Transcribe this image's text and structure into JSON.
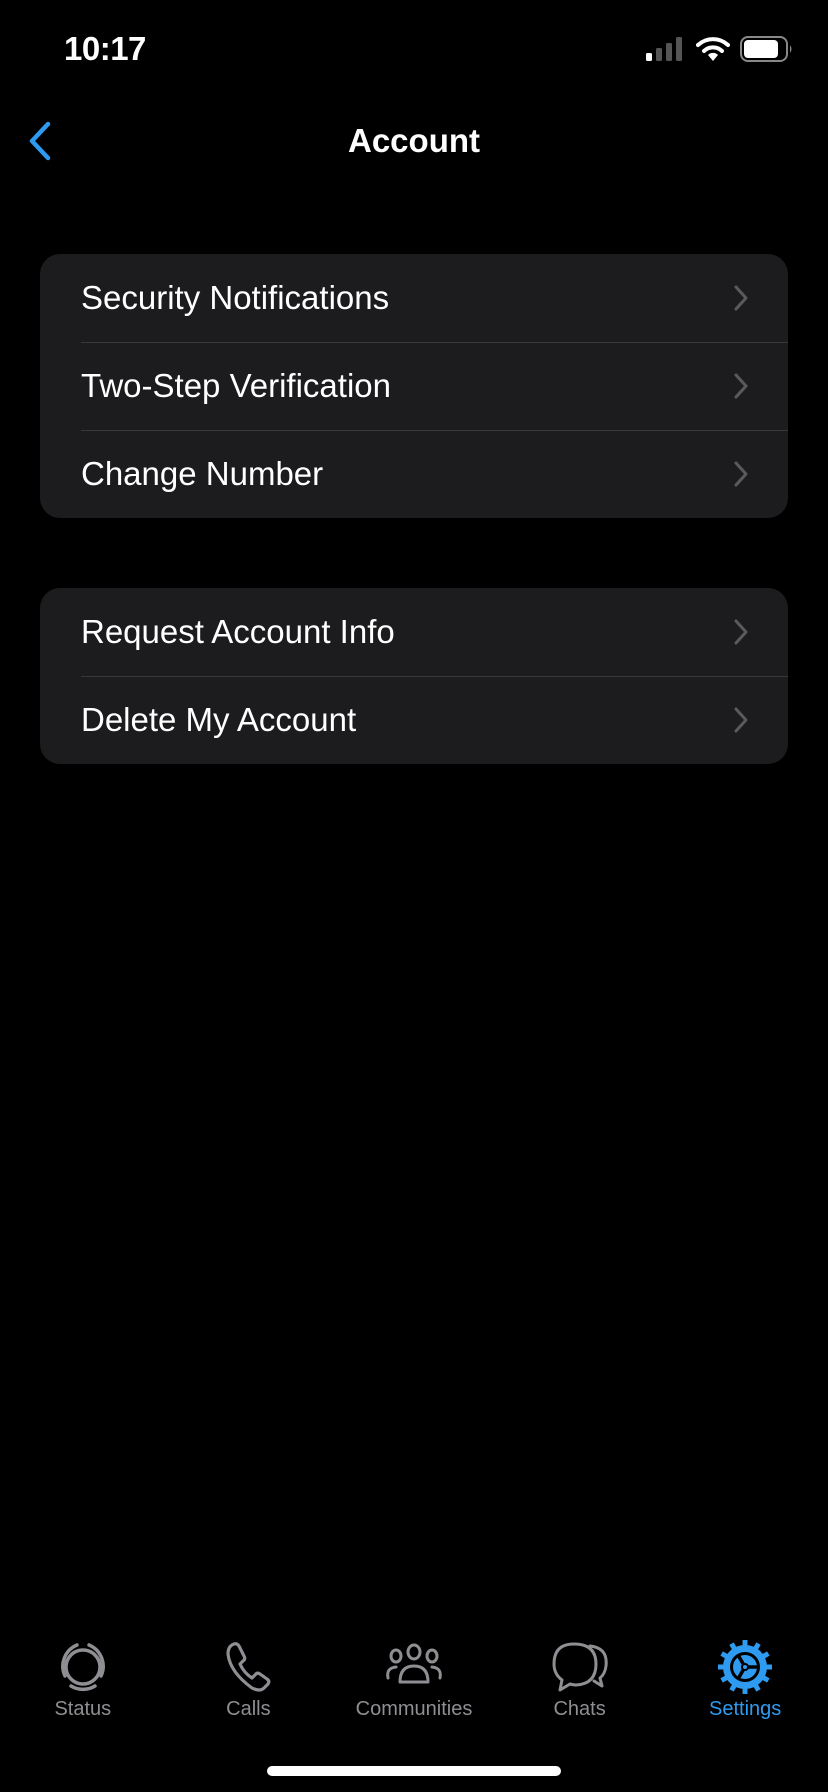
{
  "status_bar": {
    "time": "10:17",
    "icons": [
      "signal-icon",
      "wifi-icon",
      "battery-icon"
    ]
  },
  "nav": {
    "title": "Account",
    "back_icon": "chevron-left-icon"
  },
  "groups": [
    {
      "items": [
        {
          "label": "Security Notifications"
        },
        {
          "label": "Two-Step Verification"
        },
        {
          "label": "Change Number"
        }
      ]
    },
    {
      "items": [
        {
          "label": "Request Account Info"
        },
        {
          "label": "Delete My Account"
        }
      ]
    }
  ],
  "tabbar": {
    "tabs": [
      {
        "label": "Status",
        "icon": "status-icon",
        "active": false
      },
      {
        "label": "Calls",
        "icon": "phone-icon",
        "active": false
      },
      {
        "label": "Communities",
        "icon": "communities-icon",
        "active": false
      },
      {
        "label": "Chats",
        "icon": "chats-icon",
        "active": false
      },
      {
        "label": "Settings",
        "icon": "settings-gear-icon",
        "active": true
      }
    ]
  },
  "colors": {
    "accent": "#2e9bf0",
    "inactive": "#8e8e93",
    "cell": "#1c1c1e",
    "background": "#000000"
  }
}
